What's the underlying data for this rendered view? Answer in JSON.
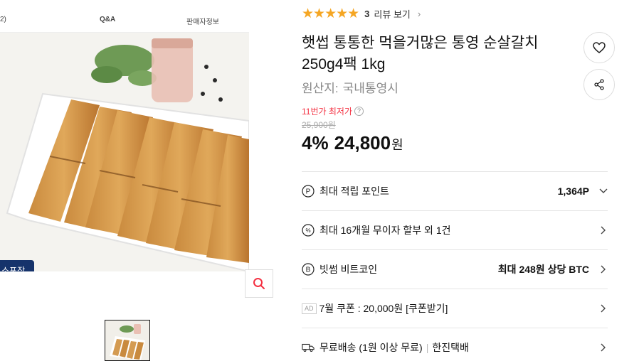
{
  "image_panel": {
    "thumb_alt": "햇썹 통통한 먹을거많은 통영 순살갈치",
    "badge_text": "소포장"
  },
  "rating": {
    "stars": "★★★★★",
    "count": "3",
    "link_label": "리뷰 보기"
  },
  "product": {
    "title": "햇썹 통통한 먹을거많은 통영 순살갈치 250g4팩 1kg",
    "origin_label": "원산지:",
    "origin_value": "국내통영시"
  },
  "price": {
    "lowest_label": "11번가 최저가",
    "original": "25,900원",
    "discount": "4%",
    "sale": "24,800",
    "currency": "원"
  },
  "benefit_rows": [
    {
      "icon": "point-icon",
      "label": "최대 적립 포인트",
      "value": "1,364P",
      "chevron": "down"
    },
    {
      "icon": "installment-icon",
      "label": "최대 16개월 무이자 할부 외 1건",
      "value": "",
      "chevron": "right"
    },
    {
      "icon": "bitcoin-icon",
      "label": "빗썸 비트코인",
      "value": "최대 248원 상당 BTC",
      "chevron": "right"
    },
    {
      "icon": "ad-tag",
      "label": "7월 쿠폰 : 20,000원 [쿠폰받기]",
      "tag": "AD",
      "value": "",
      "chevron": "right"
    },
    {
      "icon": "truck-icon",
      "label": "무료배송 (1원 이상 무료)",
      "carrier": "한진택배",
      "value": "",
      "chevron": "right"
    }
  ],
  "colors": {
    "star": "#f5a623",
    "lowest": "#f43142",
    "badge_bg": "#16336b"
  }
}
